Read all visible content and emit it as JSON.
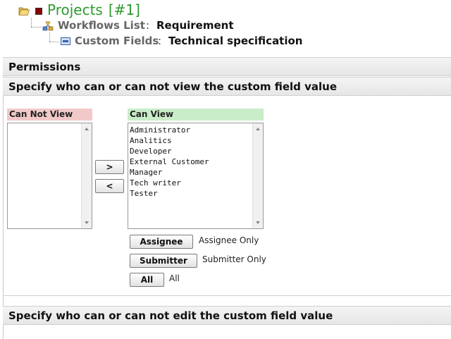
{
  "breadcrumb": {
    "project_label": "Projects",
    "project_number": "[#1]",
    "workflows_label": "Workflows List",
    "workflows_separator": ":",
    "workflows_value": "Requirement",
    "custom_fields_label": "Custom Fields",
    "custom_fields_separator": ":",
    "custom_fields_value": "Technical specification"
  },
  "panel": {
    "title": "Permissions",
    "view_section_title": "Specify who can or can not view the custom field value",
    "edit_section_title": "Specify who can or can not edit the custom field value",
    "cannot_view_label": "Can Not View",
    "can_view_label": "Can View",
    "cannot_view_items": [],
    "can_view_items": [
      "Administrator",
      "Analitics",
      "Developer",
      "External Customer",
      "Manager",
      "Tech writer",
      "Tester"
    ],
    "move_right_label": ">",
    "move_left_label": "<",
    "assignee_button": "Assignee",
    "assignee_desc": "Assignee Only",
    "submitter_button": "Submitter",
    "submitter_desc": "Submitter Only",
    "all_button": "All",
    "all_desc": "All"
  },
  "icons": {
    "folder": "folder-open-icon",
    "project": "project-icon",
    "workflow": "workflow-icon",
    "custom_field": "custom-field-icon"
  },
  "colors": {
    "project_title": "#2e9a2e",
    "cannot_header_bg": "#f2c9c9",
    "can_header_bg": "#c9ecc9"
  }
}
